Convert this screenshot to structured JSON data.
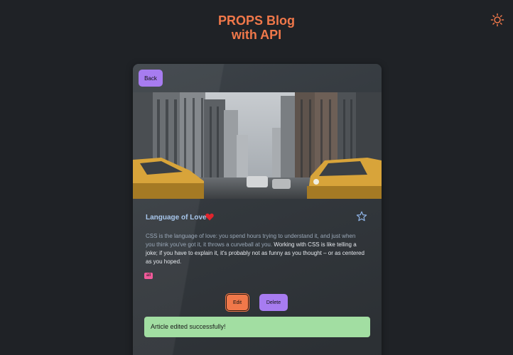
{
  "header": {
    "title_line1": "PROPS Blog",
    "title_line2": "with API",
    "theme_icon": "sun-icon",
    "accent_color": "#f0784a"
  },
  "article": {
    "back_label": "Back",
    "image_icon": "city-street-photo",
    "title": "Language of Love",
    "title_emoji_icon": "heart-icon",
    "favorite_icon": "star-icon",
    "body_muted": "CSS is the language of love: you spend hours trying to understand it, and just when you think you've got it, it throws a curveball at you. ",
    "body_highlight": "Working with CSS is like telling a joke; if you have to explain it, it's probably not as funny as you thought – or as centered as you hoped.",
    "tag": "all",
    "edit_label": "Edit",
    "delete_label": "Delete"
  },
  "toast": {
    "message": "Article edited successfully!",
    "color": "#a2dea2"
  }
}
